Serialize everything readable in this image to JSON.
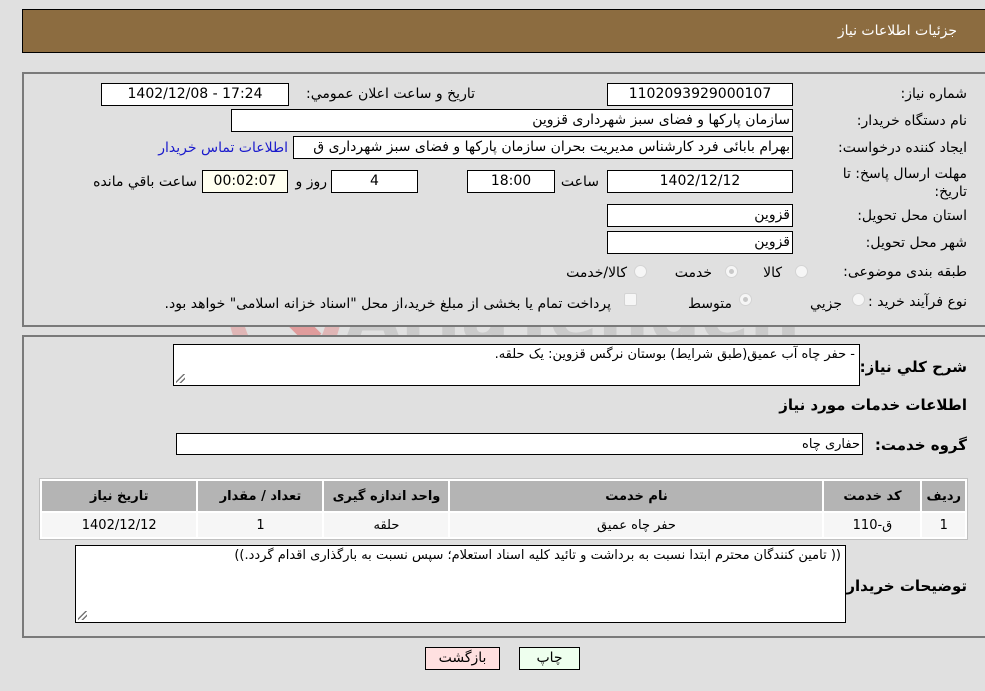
{
  "header": {
    "title": "جزئیات اطلاعات نیاز"
  },
  "form": {
    "need_number": {
      "label": "شماره نیاز:",
      "value": "1102093929000107"
    },
    "announce_datetime": {
      "label": "تاریخ و ساعت اعلان عمومي:",
      "value": "1402/12/08 - 17:24"
    },
    "buyer_org": {
      "label": "نام دستگاه خریدار:",
      "value": "سازمان پارکها و فضای سبز شهرداری قزوین"
    },
    "requester": {
      "label": "ایجاد کننده درخواست:",
      "value": "بهرام بابائی فرد کارشناس مدیریت بحران سازمان پارکها و فضای سبز شهرداری ق"
    },
    "buyer_contact_link": "اطلاعات تماس خریدار",
    "deadline": {
      "label": "مهلت ارسال پاسخ: تا تاریخ:",
      "date": "1402/12/12",
      "time_label": "ساعت",
      "time": "18:00",
      "days": "4",
      "days_label": "روز و",
      "remaining": "00:02:07",
      "remaining_label": "ساعت باقي مانده"
    },
    "province": {
      "label": "استان محل تحویل:",
      "value": "قزوین"
    },
    "city": {
      "label": "شهر محل تحویل:",
      "value": "قزوین"
    },
    "category": {
      "label": "طبقه بندی موضوعی:",
      "options": [
        "کالا",
        "خدمت",
        "کالا/خدمت"
      ],
      "selected": "خدمت"
    },
    "purchase_type": {
      "label": "نوع فرآیند خرید :",
      "options": [
        "جزيي",
        "متوسط"
      ],
      "selected": "متوسط",
      "treasury_checkbox_label": "پرداخت تمام یا بخشی از مبلغ خرید،از محل \"اسناد خزانه اسلامی\" خواهد بود.",
      "treasury_checked": false
    }
  },
  "details": {
    "description_label": "شرح کلي نیاز:",
    "description": "- حفر چاه آب عمیق(طبق شرایط) بوستان نرگس قزوین: یک حلقه.",
    "services_title": "اطلاعات خدمات مورد نیاز",
    "service_group_label": "گروه خدمت:",
    "service_group": "حفاری چاه",
    "table": {
      "headers": [
        "ردیف",
        "کد خدمت",
        "نام خدمت",
        "واحد اندازه گیری",
        "تعداد / مقدار",
        "تاریخ نیاز"
      ],
      "rows": [
        [
          "1",
          "ق-110",
          "حفر چاه عمیق",
          "حلقه",
          "1",
          "1402/12/12"
        ]
      ]
    },
    "buyer_notes_label": "توضیحات خریدار:",
    "buyer_notes": "(( تامین کنندگان محترم ابتدا نسبت به برداشت و تائید کلیه اسناد استعلام؛ سپس نسبت به بارگذاری اقدام گردد.))"
  },
  "buttons": {
    "print": "چاپ",
    "back": "بازگشت"
  },
  "watermark": "AriaTender.neT",
  "colors": {
    "header_bg": "#8c6c40",
    "print_bg": "#eeffee",
    "back_bg": "#ffe0e0",
    "link": "#1a1acc"
  }
}
